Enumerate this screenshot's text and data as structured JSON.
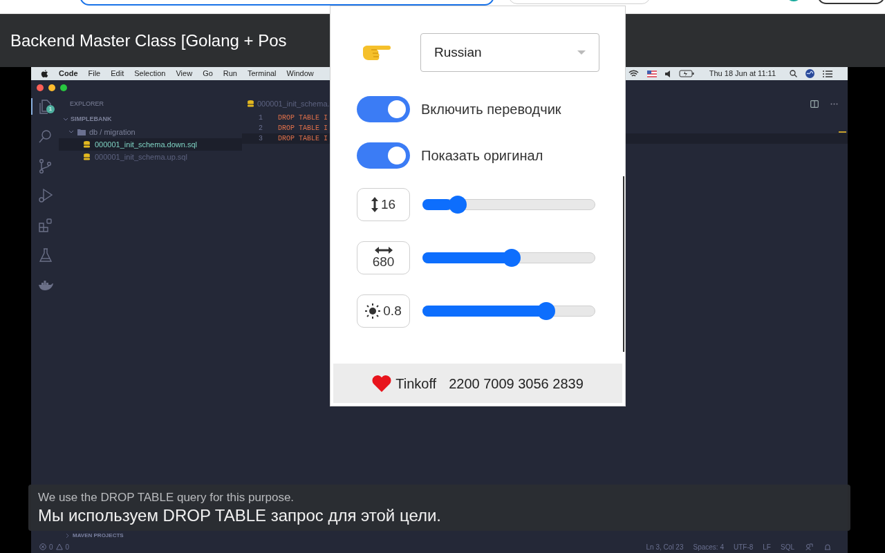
{
  "course_title": "Backend Master Class [Golang + Pos",
  "video": {
    "menu_bar": {
      "app": "Code",
      "items": [
        "File",
        "Edit",
        "Selection",
        "View",
        "Go",
        "Run",
        "Terminal",
        "Window"
      ],
      "clock": "Thu 18 Jun at 11:11"
    },
    "activity_bar": [
      {
        "kind": "files",
        "badge": "1",
        "selected": true
      },
      {
        "kind": "search",
        "selected": false
      },
      {
        "kind": "source-control",
        "selected": false
      },
      {
        "kind": "run",
        "selected": false
      },
      {
        "kind": "extensions",
        "selected": false
      },
      {
        "kind": "testing",
        "selected": false
      },
      {
        "kind": "docker",
        "selected": false
      }
    ],
    "explorer": {
      "title": "EXPLORER",
      "project": "SIMPLEBANK",
      "folder": "db / migration",
      "files": [
        {
          "name": "000001_init_schema.down.sql",
          "selected": true
        },
        {
          "name": "000001_init_schema.up.sql",
          "selected": false
        }
      ],
      "panels": [
        "MAVEN PROJECTS"
      ]
    },
    "editor": {
      "tab": "000001_init_schema.",
      "lines": [
        {
          "number": "1",
          "code": "DROP TABLE I"
        },
        {
          "number": "2",
          "code": "DROP TABLE I"
        },
        {
          "number": "3",
          "code": "DROP TABLE I"
        }
      ]
    },
    "status_bar": {
      "errors": "0",
      "warnings": "0",
      "items": [
        "Ln 3, Col 23",
        "Spaces: 4",
        "UTF-8",
        "LF",
        "SQL"
      ]
    },
    "captions": {
      "original": "We use the DROP TABLE query for this purpose.",
      "translation": "Мы используем DROP TABLE запрос для этой цели."
    }
  },
  "popup": {
    "language": "Russian",
    "toggles": [
      {
        "label": "Включить переводчик",
        "on": true
      },
      {
        "label": "Показать оригинал",
        "on": true
      }
    ],
    "sliders": [
      {
        "kind": "font-size",
        "value": "16",
        "level": 0.17
      },
      {
        "kind": "width",
        "value": "680",
        "level": 0.52
      },
      {
        "kind": "opacity",
        "value": "0.8",
        "level": 0.74
      }
    ],
    "donation": {
      "bank": "Tinkoff",
      "card": "2200 7009 3056 2839"
    }
  }
}
